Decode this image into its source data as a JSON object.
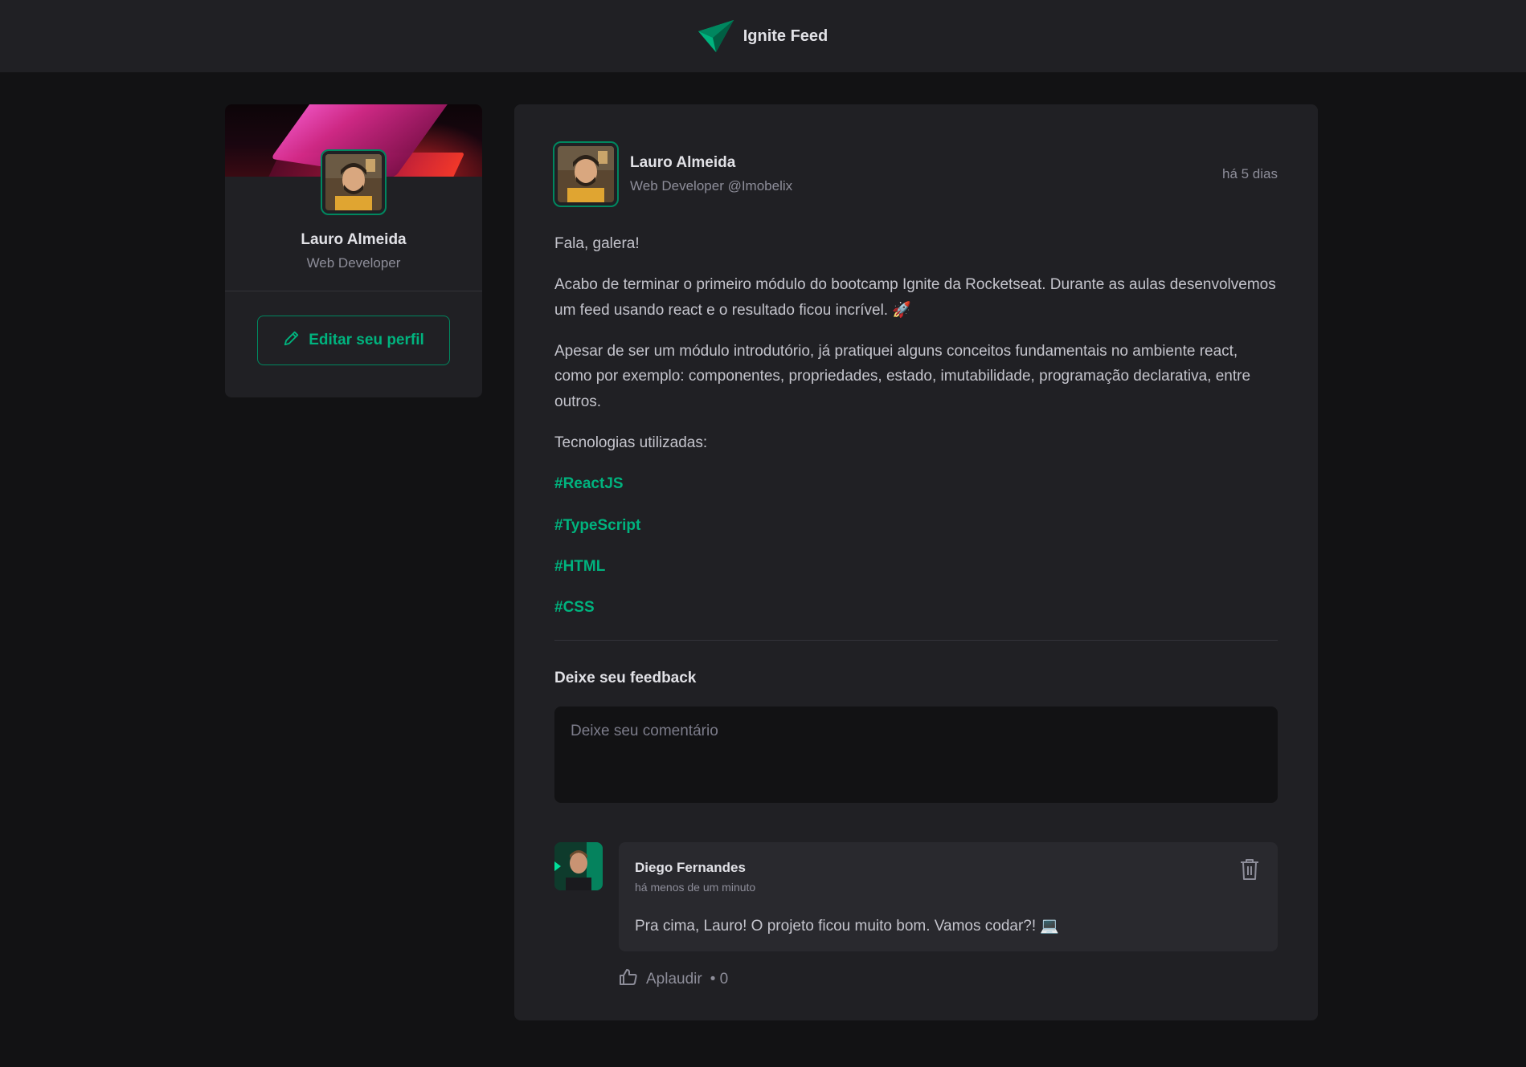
{
  "header": {
    "app_title": "Ignite Feed",
    "logo_icon": "paper-plane-logo",
    "accent_color": "#00b37e"
  },
  "sidebar": {
    "name": "Lauro Almeida",
    "role": "Web Developer",
    "edit_label": "Editar seu perfil",
    "edit_icon": "pencil-icon"
  },
  "post": {
    "author": {
      "name": "Lauro Almeida",
      "role": "Web Developer @Imobelix"
    },
    "time": "há 5 dias",
    "paragraphs": [
      "Fala, galera!",
      "Acabo de terminar o primeiro módulo do bootcamp Ignite da Rocketseat. Durante as aulas desenvolvemos um feed usando react e o resultado ficou incrível. 🚀",
      "Apesar de ser um módulo introdutório, já pratiquei alguns conceitos fundamentais no ambiente react, como por exemplo: componentes, propriedades, estado, imutabilidade, programação declarativa, entre outros.",
      "Tecnologias utilizadas:"
    ],
    "tags": [
      "#ReactJS",
      "#TypeScript",
      "#HTML",
      "#CSS"
    ],
    "feedback_title": "Deixe seu feedback",
    "comment_placeholder": "Deixe seu comentário"
  },
  "comment": {
    "author": "Diego Fernandes",
    "time": "há menos de um minuto",
    "text": "Pra cima, Lauro! O projeto ficou muito bom. Vamos codar?! 💻",
    "applaud_label": "Aplaudir",
    "applaud_count": "• 0",
    "delete_icon": "trash-icon",
    "like_icon": "thumbs-up-icon"
  }
}
